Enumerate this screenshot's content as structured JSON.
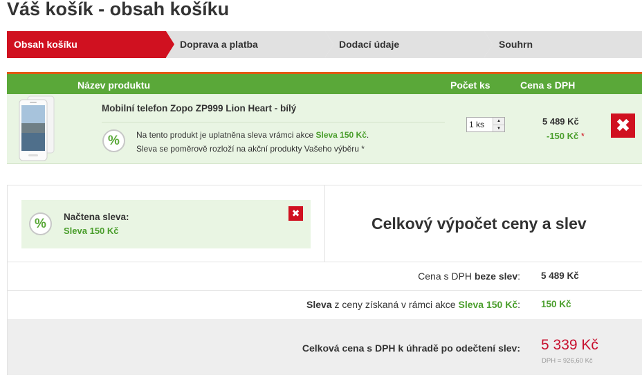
{
  "page": {
    "title": "Váš košík - obsah košíku"
  },
  "steps": [
    {
      "label": "Obsah košíku",
      "active": true
    },
    {
      "label": "Doprava a platba",
      "active": false
    },
    {
      "label": "Dodací údaje",
      "active": false
    },
    {
      "label": "Souhrn",
      "active": false
    }
  ],
  "cart": {
    "headers": {
      "product": "Název produktu",
      "qty": "Počet ks",
      "price": "Cena s DPH"
    },
    "item": {
      "name": "Mobilní telefon Zopo ZP999 Lion Heart - bílý",
      "badge": "%",
      "discount_line1_pre": "Na tento produkt je uplatněna sleva vrámci akce ",
      "discount_line1_highlight": "Sleva 150 Kč",
      "discount_line1_post": ".",
      "discount_line2": "Sleva se poměrově rozloží na akční produkty Vašeho výběru *",
      "qty": "1 ks",
      "price": "5 489 Kč",
      "discount": "-150 Kč",
      "discount_mark": "*",
      "remove": "✖"
    }
  },
  "summary": {
    "voucher": {
      "badge": "%",
      "title": "Načtena sleva:",
      "value": "Sleva 150 Kč",
      "remove": "✖"
    },
    "calc_title": "Celkový výpočet ceny a slev",
    "rows": {
      "no_discount": {
        "pre": "Cena s DPH ",
        "bold": "beze slev",
        "post": ":",
        "value": "5 489 Kč"
      },
      "discount": {
        "bold": "Sleva",
        "mid": " z ceny získaná v rámci akce ",
        "highlight": "Sleva 150 Kč",
        "post": ":",
        "value": "150 Kč"
      },
      "total": {
        "label": "Celková cena s DPH k úhradě po odečtení slev:",
        "value": "5 339 Kč",
        "dph": "DPH = 926,60 Kč"
      }
    }
  },
  "colors": {
    "accent_red": "#d01120",
    "green_bar": "#5aa839",
    "green_text": "#4a9e2c",
    "row_bg": "#e9f5e3",
    "step_bg": "#e1e1e1"
  },
  "icons": {
    "percent": "percent-badge-icon",
    "remove": "close-icon",
    "spinner": "spin-arrows-icon"
  }
}
